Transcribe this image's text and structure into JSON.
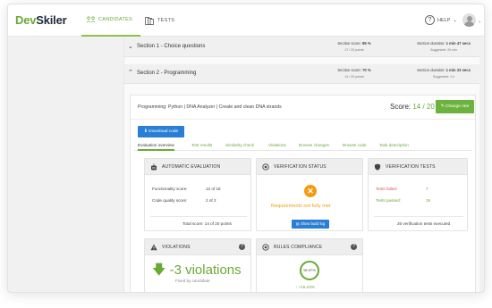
{
  "app": {
    "logo_part1": "Dev",
    "logo_part2": "Skiler"
  },
  "nav": {
    "candidates_label": "CANDIDATES",
    "tests_label": "TESTS",
    "help_label": "HELP"
  },
  "sections": [
    {
      "title": "Section 1 - Choice questions",
      "score_label": "Section score:",
      "score_value": "85 %",
      "points": "17 / 20 points",
      "duration_label": "Section duration:",
      "duration_value": "1 min 47 secs",
      "suggested": "Suggested: 20 min"
    },
    {
      "title": "Section 2 - Programming",
      "score_label": "Section score:",
      "score_value": "70 %",
      "points": "14 / 20 points",
      "duration_label": "Section duration:",
      "duration_value": "1 min 33 secs",
      "suggested": "Suggested: 1 h"
    }
  ],
  "task": {
    "title": "Programming: Python | DNA Analyzer | Create and clean DNA strands",
    "score_label": "Score:",
    "score_value": "14 / 20",
    "change_rate_label": "Change rate",
    "download_label": "Download code"
  },
  "tabs": [
    {
      "label": "Evaluation overview",
      "active": true
    },
    {
      "label": "Test results",
      "active": false
    },
    {
      "label": "Similarity check",
      "active": false
    },
    {
      "label": "Violations",
      "active": false
    },
    {
      "label": "Browse changes",
      "active": false
    },
    {
      "label": "Browse code",
      "active": false
    },
    {
      "label": "Task description",
      "active": false
    }
  ],
  "auto_eval": {
    "title": "AUTOMATIC EVALUATION",
    "functionality_label": "Functionality score:",
    "functionality_value": "12 of 18",
    "quality_label": "Code quality score:",
    "quality_value": "2 of 2",
    "total": "Total score: 14 of 20 points"
  },
  "verification_status": {
    "title": "VERIFICATION STATUS",
    "status_text": "Requirements not fully met",
    "build_log_label": "Show build log"
  },
  "verification_tests": {
    "title": "VERIFICATION TESTS",
    "failed_label": "Tests failed:",
    "failed_value": "7",
    "passed_label": "Tests passed:",
    "passed_value": "19",
    "total": "26 verification tests executed"
  },
  "violations": {
    "title": "VIOLATIONS",
    "big_text": "-3 violations",
    "sub_text": "Fixed by candidate"
  },
  "rules": {
    "title": "RULES COMPLIANCE",
    "ring_value": "96.97%",
    "delta": "+15.24%"
  },
  "colors": {
    "brand_green": "#6aa936",
    "button_blue": "#2a7fd4",
    "warning_orange": "#f39c12",
    "failed_red": "#d9534f"
  }
}
